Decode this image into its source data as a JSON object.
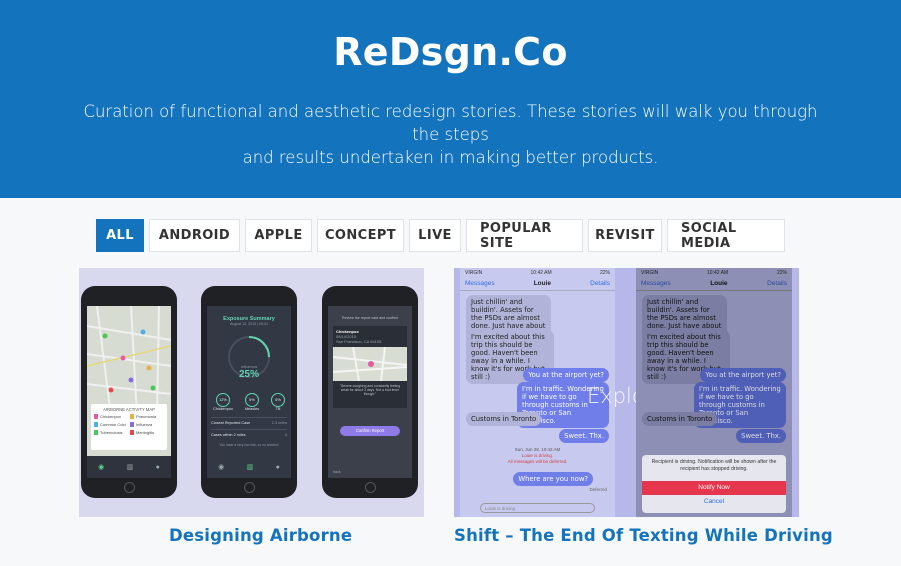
{
  "hero": {
    "title": "ReDsgn.Co",
    "subtitle_line1": "Curation of functional and aesthetic redesign stories. These stories will walk you through the steps",
    "subtitle_line2": "and results undertaken in making better products."
  },
  "filters": [
    {
      "label": "ALL",
      "active": true
    },
    {
      "label": "ANDROID"
    },
    {
      "label": "APPLE"
    },
    {
      "label": "CONCEPT"
    },
    {
      "label": "LIVE"
    },
    {
      "label": "POPULAR SITE"
    },
    {
      "label": "REVISIT"
    },
    {
      "label": "SOCIAL MEDIA"
    }
  ],
  "cards": [
    {
      "title": "Designing Airborne",
      "phone1": {
        "map_title": "AIRBORNE ACTIVITY MAP",
        "legend": [
          "Chickenpox",
          "Pneumonia",
          "Common Cold",
          "Influenza",
          "Tuberculosis",
          "Meningitis"
        ]
      },
      "phone2": {
        "title": "Exposure Summary",
        "date": "August 12, 2015 | 09:41",
        "center_label": "Influenza",
        "center_value": "25%",
        "ring_values": [
          "12%",
          "5%",
          "6%"
        ],
        "ring_labels": [
          "Chickenpox",
          "Measles",
          "TB"
        ],
        "row1": "Closest Reported Case",
        "row1_val": "2.3 miles",
        "row2": "Cases within 2 miles",
        "row2_val": "3",
        "note": "You have a very low risk, so no worries!"
      },
      "phone3": {
        "header": "Review the report card and confirm",
        "case": "Chickenpox",
        "case_date": "08/14/2015",
        "case_place": "San Francisco, CA 94105",
        "quote": "\"Severe coughing and constantly feeling weak for about 3 days. Not a bad fever though.\"",
        "button": "Confirm Report",
        "back": "back"
      }
    },
    {
      "title": "Shift – The End Of Texting While Driving",
      "overlay": "Explore",
      "status_carrier": "VIRGIN",
      "status_time": "10:42 AM",
      "status_battery": "22%",
      "nav_back": "Messages",
      "nav_title": "Louie",
      "nav_details": "Details",
      "m1": "Just chillin' and buildin'. Assets for the PSDs are almost done. Just have about a dozen items left.",
      "m2": "I'm excited about this trip this should be good. Haven't been away in a while. I know it's for work but still :)",
      "m3": "You at the airport yet?",
      "m4": "I'm in traffic. Wondering if we have to go through customs in Toronto or San Francisco.",
      "m5": "Customs in Toronto",
      "m6": "Sweet. Thx.",
      "system_date": "Sun, Jun 28, 10:42 AM",
      "system_1": "Louie is driving.",
      "system_2": "All messages will be deferred.",
      "m7": "Where are you now?",
      "deferred": "Deferred",
      "input_placeholder": "Louie is driving",
      "dialog_text": "Recipient is driving. Notification will be shown after the recipient has stopped driving.",
      "notify": "Notify Now",
      "cancel": "Cancel"
    }
  ],
  "colors": {
    "brand": "#1473bd",
    "title_link": "#1473bd",
    "bg": "#f7f8fa"
  }
}
